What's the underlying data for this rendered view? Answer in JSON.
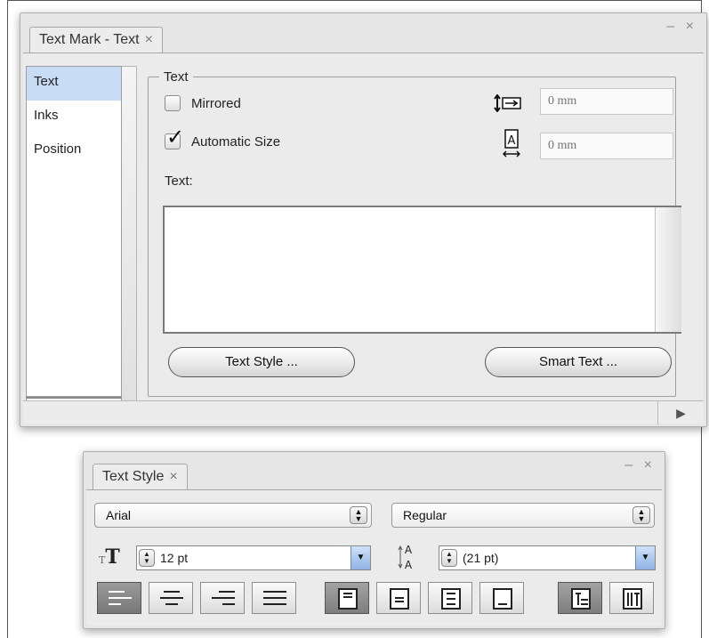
{
  "panel1": {
    "tab_label": "Text Mark - Text",
    "close_glyph": "×",
    "window_controls": "– ×",
    "nav_items": [
      "Text",
      "Inks",
      "Position"
    ],
    "group_label": "Text",
    "mirrored_label": "Mirrored",
    "mirrored_checked": false,
    "auto_size_label": "Automatic Size",
    "auto_size_checked": true,
    "field1_placeholder": "0 mm",
    "field2_placeholder": "0 mm",
    "field1_icon": "line-spacing-icon",
    "field2_icon": "character-width-icon",
    "text_label": "Text:",
    "text_value": "",
    "text_style_button": "Text Style ...",
    "smart_text_button": "Smart Text ...",
    "status_arrow_icon": "play-arrow-icon"
  },
  "panel2": {
    "tab_label": "Text Style",
    "close_glyph": "×",
    "window_controls": "– ×",
    "font_family": "Arial",
    "font_style": "Regular",
    "font_size": "12 pt",
    "leading": "(21 pt)",
    "font_size_icon": "font-size-icon",
    "leading_icon": "leading-icon",
    "align_buttons": [
      "align-left",
      "align-center",
      "align-right",
      "justify"
    ],
    "align_selected": "align-left",
    "vertical_buttons": [
      "valign-top",
      "valign-center",
      "valign-justify",
      "valign-bottom"
    ],
    "vertical_selected": "valign-top",
    "direction_buttons": [
      "horizontal-text",
      "vertical-text"
    ],
    "direction_selected": "horizontal-text"
  }
}
